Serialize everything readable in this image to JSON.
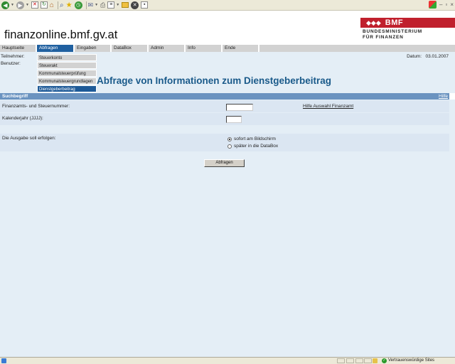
{
  "browser": {
    "toolbar_icons": [
      "back-icon",
      "forward-icon",
      "stop-icon",
      "refresh-icon",
      "home-icon",
      "search-icon",
      "favorites-icon",
      "history-icon",
      "mail-icon",
      "print-icon",
      "edit-icon",
      "folder-icon",
      "messenger-icon",
      "page-icon"
    ],
    "window_controls": [
      "minimize-icon",
      "maximize-icon",
      "close-icon"
    ]
  },
  "header": {
    "site_title": "finanzonline.bmf.gv.at",
    "logo_abbr": "BMF",
    "logo_line1": "BUNDESMINISTERIUM",
    "logo_line2": "FÜR FINANZEN",
    "logo_color": "#c0202d"
  },
  "nav": {
    "items": [
      {
        "label": "Hauptseite"
      },
      {
        "label": "Abfragen"
      },
      {
        "label": "Eingaben"
      },
      {
        "label": "DataBox"
      },
      {
        "label": "Admin"
      },
      {
        "label": "Info"
      },
      {
        "label": "Ende"
      }
    ],
    "active": "Abfragen",
    "active_color": "#2060a0"
  },
  "dropdown": {
    "items": [
      {
        "label": "Steuerkonto"
      },
      {
        "label": "Steuerakt"
      },
      {
        "label": "Kommunalsteuerprüfung"
      },
      {
        "label": "Kommunalsteuergrundlagen"
      },
      {
        "label": "Dienstgeberbeitrag"
      }
    ],
    "active": "Dienstgeberbeitrag"
  },
  "user_info": {
    "teilnehmer_label": "Teilnehmer:",
    "benutzer_label": "Benutzer:",
    "date_label": "Datum:",
    "date_value": "03.01.2007"
  },
  "page": {
    "heading": "Abfrage von Informationen zum Dienstgeberbeitrag"
  },
  "form": {
    "section_title": "Suchbegriff",
    "help_link": "Hilfe",
    "fields": {
      "finanzamt_label": "Finanzamts- und Steuernummer:",
      "finanzamt_help_link": "Hilfe Auswahl Finanzamt",
      "year_label": "Kalenderjahr (JJJJ):",
      "output_label": "Die Ausgabe soll erfolgen:",
      "output_options": [
        {
          "label": "sofort am Bildschirm",
          "checked": true
        },
        {
          "label": "später in die DataBox",
          "checked": false
        }
      ]
    },
    "submit_label": "Abfragen"
  },
  "status_bar": {
    "zone": "Vertrauenswürdige Sites"
  }
}
